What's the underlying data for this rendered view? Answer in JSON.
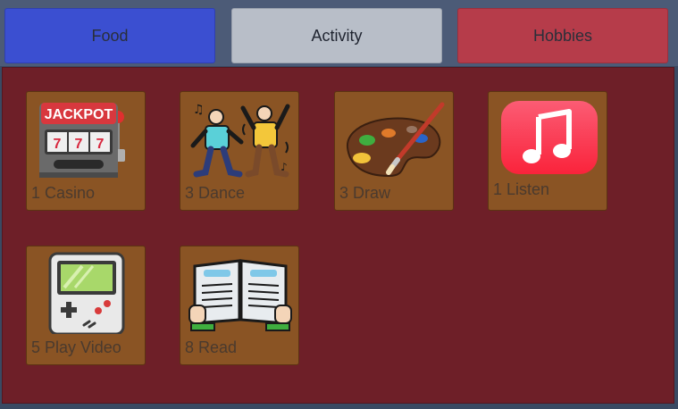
{
  "tabs": [
    {
      "label": "Food",
      "color": "#3b4fd1"
    },
    {
      "label": "Activity",
      "color": "#b8bec8"
    },
    {
      "label": "Hobbies",
      "color": "#b63c4a"
    }
  ],
  "activities": [
    {
      "label": "1 Casino",
      "icon": "slot-machine-icon"
    },
    {
      "label": "3 Dance",
      "icon": "dancing-people-icon"
    },
    {
      "label": "3 Draw",
      "icon": "paint-palette-icon"
    },
    {
      "label": "1 Listen",
      "icon": "music-note-icon"
    },
    {
      "label": "5 Play Video",
      "icon": "handheld-game-icon"
    },
    {
      "label": "8 Read",
      "icon": "open-book-icon"
    }
  ],
  "casino_icon_text": "JACKPOT",
  "colors": {
    "panel": "#6e1f28",
    "card": "#8a5424",
    "tabbar": "#4c5b77"
  }
}
